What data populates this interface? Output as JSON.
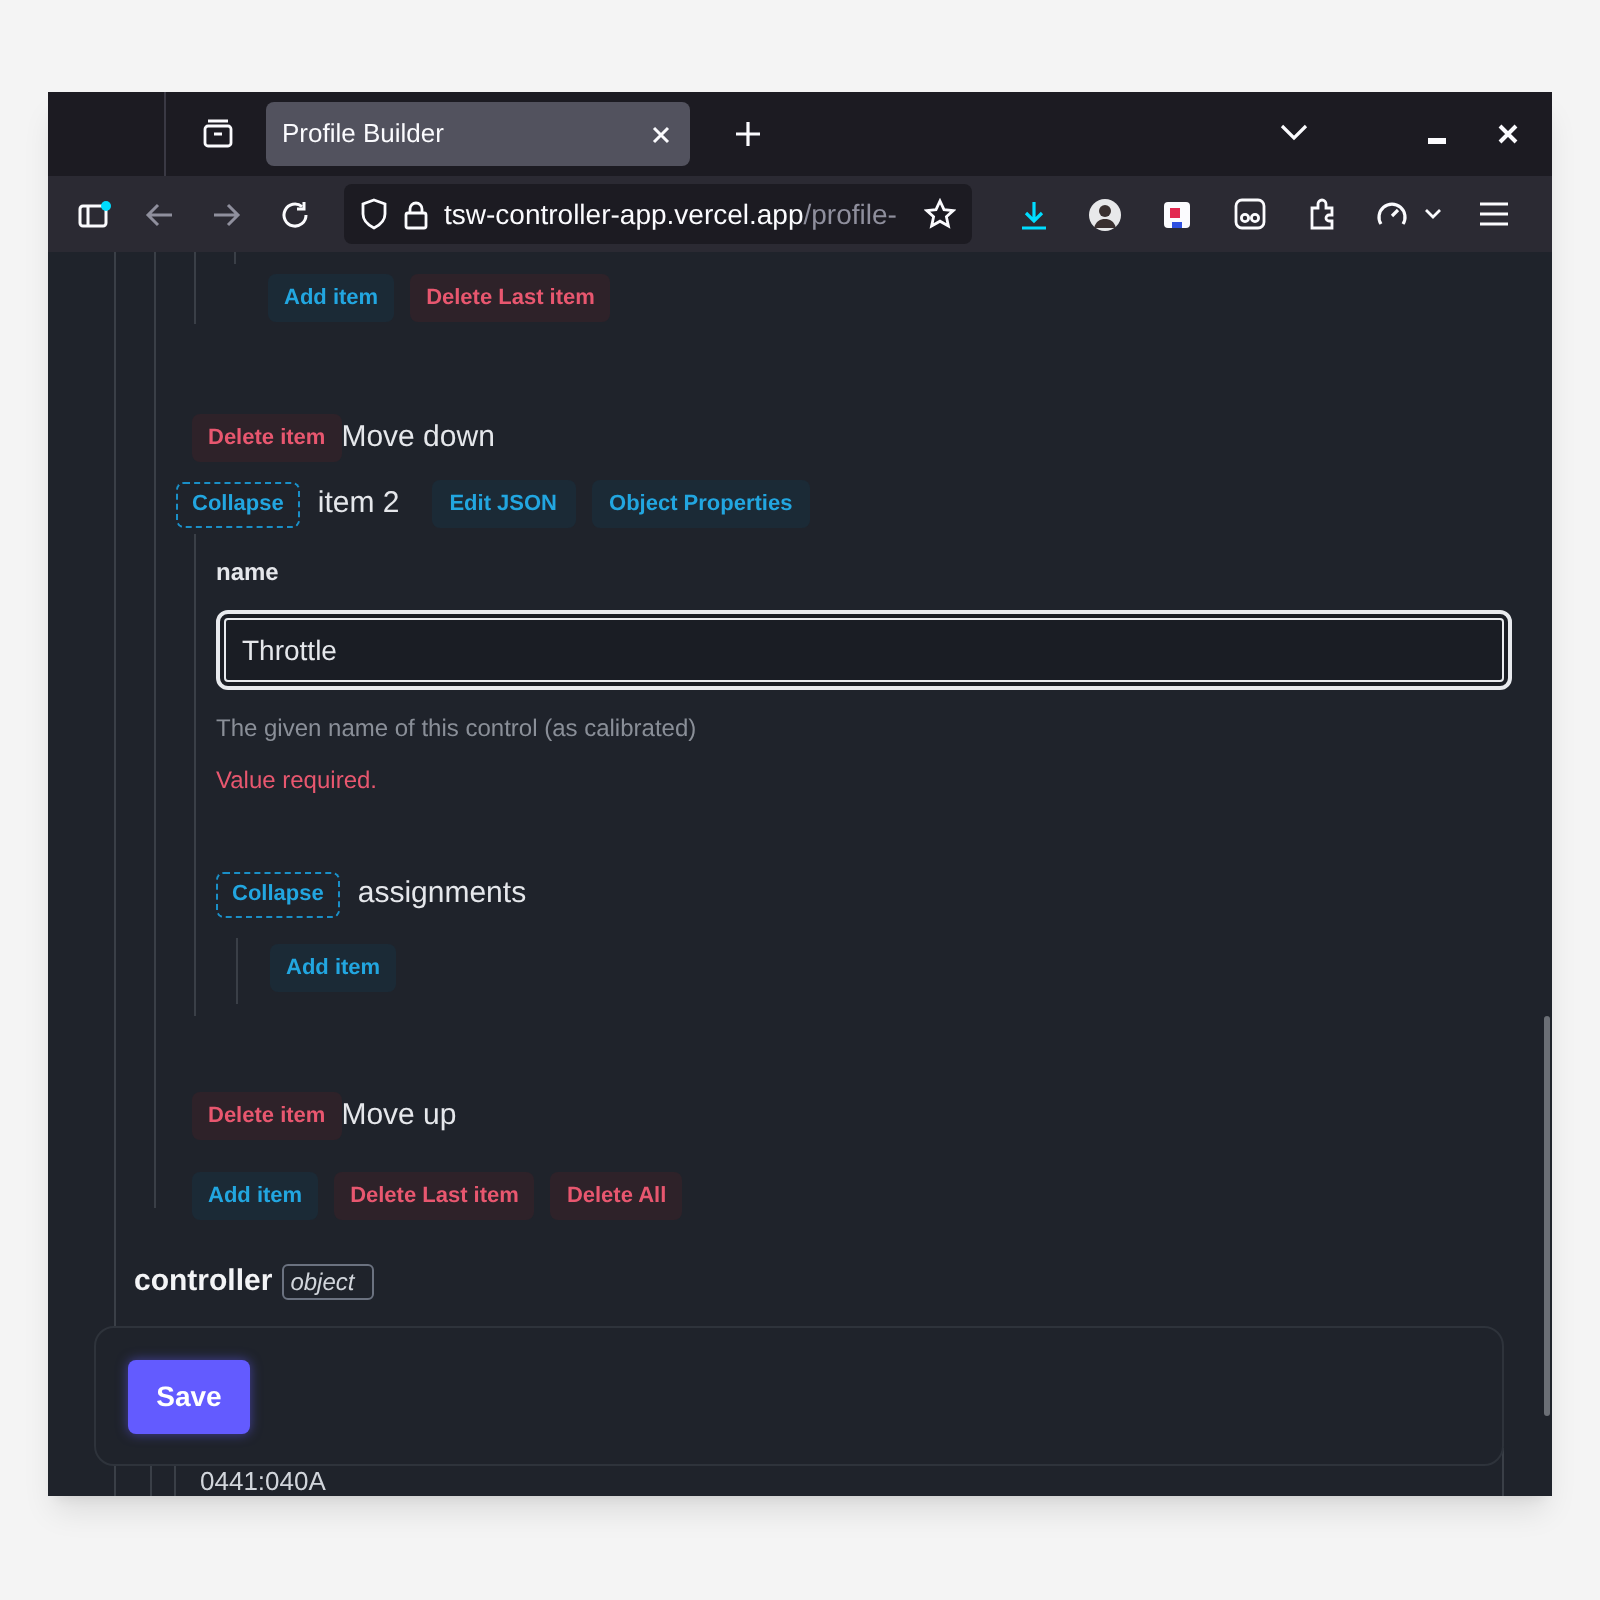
{
  "browser": {
    "tabs": [
      {
        "title": "Profile Builder",
        "selected": true
      }
    ],
    "url_host": "tsw-controller-app.vercel.app",
    "url_path": "/profile-"
  },
  "upper_actions": [
    {
      "label": "Add item",
      "kind": "add"
    },
    {
      "label": "Delete Last item",
      "kind": "delete"
    }
  ],
  "item_controls_1": {
    "delete": "Delete item",
    "move": "Move down"
  },
  "item": {
    "collapse": "Collapse",
    "title": "item 2",
    "buttons": [
      {
        "label": "Edit JSON"
      },
      {
        "label": "Object Properties"
      }
    ],
    "field": {
      "label": "name",
      "value": "Throttle",
      "hint": "The given name of this control (as calibrated)",
      "error": "Value required."
    },
    "assignments": {
      "collapse": "Collapse",
      "title": "assignments",
      "actions": [
        {
          "label": "Add item",
          "kind": "add"
        }
      ]
    }
  },
  "item_controls_2": {
    "delete": "Delete item",
    "move": "Move up"
  },
  "list_actions": [
    {
      "label": "Add item",
      "kind": "add"
    },
    {
      "label": "Delete Last item",
      "kind": "delete"
    },
    {
      "label": "Delete All",
      "kind": "delete"
    }
  ],
  "controller": {
    "title": "controller",
    "type": "object"
  },
  "save": "Save",
  "clipped_value": "0441:040A"
}
